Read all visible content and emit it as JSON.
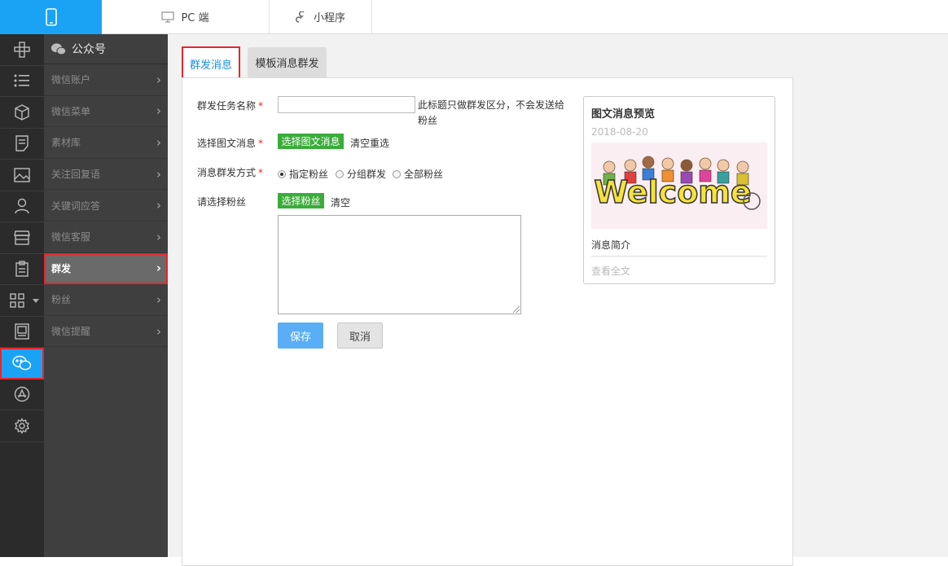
{
  "topbar": {
    "mobile_icon": "mobile-phone-icon",
    "tabs": [
      {
        "label": "PC 端",
        "icon": "monitor-icon"
      },
      {
        "label": "小程序",
        "icon": "mini-program-icon"
      }
    ]
  },
  "rail": {
    "items": [
      "plugin-icon",
      "list-icon",
      "cube-icon",
      "document-icon",
      "image-icon",
      "user-icon",
      "store-icon",
      "clipboard-icon",
      "apps-grid-icon",
      "page-icon",
      "wechat-icon",
      "appstore-icon",
      "gear-icon"
    ],
    "active": "wechat-icon"
  },
  "sidebar": {
    "header": "公众号",
    "header_icon": "wechat-icon",
    "items": [
      {
        "label": "微信账户"
      },
      {
        "label": "微信菜单"
      },
      {
        "label": "素材库"
      },
      {
        "label": "关注回复语"
      },
      {
        "label": "关键词应答"
      },
      {
        "label": "微信客服"
      },
      {
        "label": "群发"
      },
      {
        "label": "粉丝"
      },
      {
        "label": "微信提醒"
      }
    ],
    "active": "群发"
  },
  "tabs": [
    {
      "label": "群发消息",
      "active": true
    },
    {
      "label": "模板消息群发",
      "active": false
    }
  ],
  "form": {
    "task_name": {
      "label": "群发任务名称",
      "required": "*",
      "value": "",
      "hint": "此标题只做群发区分，不会发送给粉丝"
    },
    "select_news": {
      "label": "选择图文消息",
      "required": "*",
      "button": "选择图文消息",
      "reset": "清空重选"
    },
    "send_mode": {
      "label": "消息群发方式",
      "required": "*",
      "options": [
        "指定粉丝",
        "分组群发",
        "全部粉丝"
      ],
      "selected": "指定粉丝"
    },
    "select_fans": {
      "label": "请选择粉丝",
      "button": "选择粉丝",
      "clear": "清空",
      "value": ""
    },
    "save": "保存",
    "cancel": "取消"
  },
  "preview": {
    "title": "图文消息预览",
    "date": "2018-08-20",
    "image_text": "Welcome",
    "summary": "消息简介",
    "read_more": "查看全文"
  }
}
